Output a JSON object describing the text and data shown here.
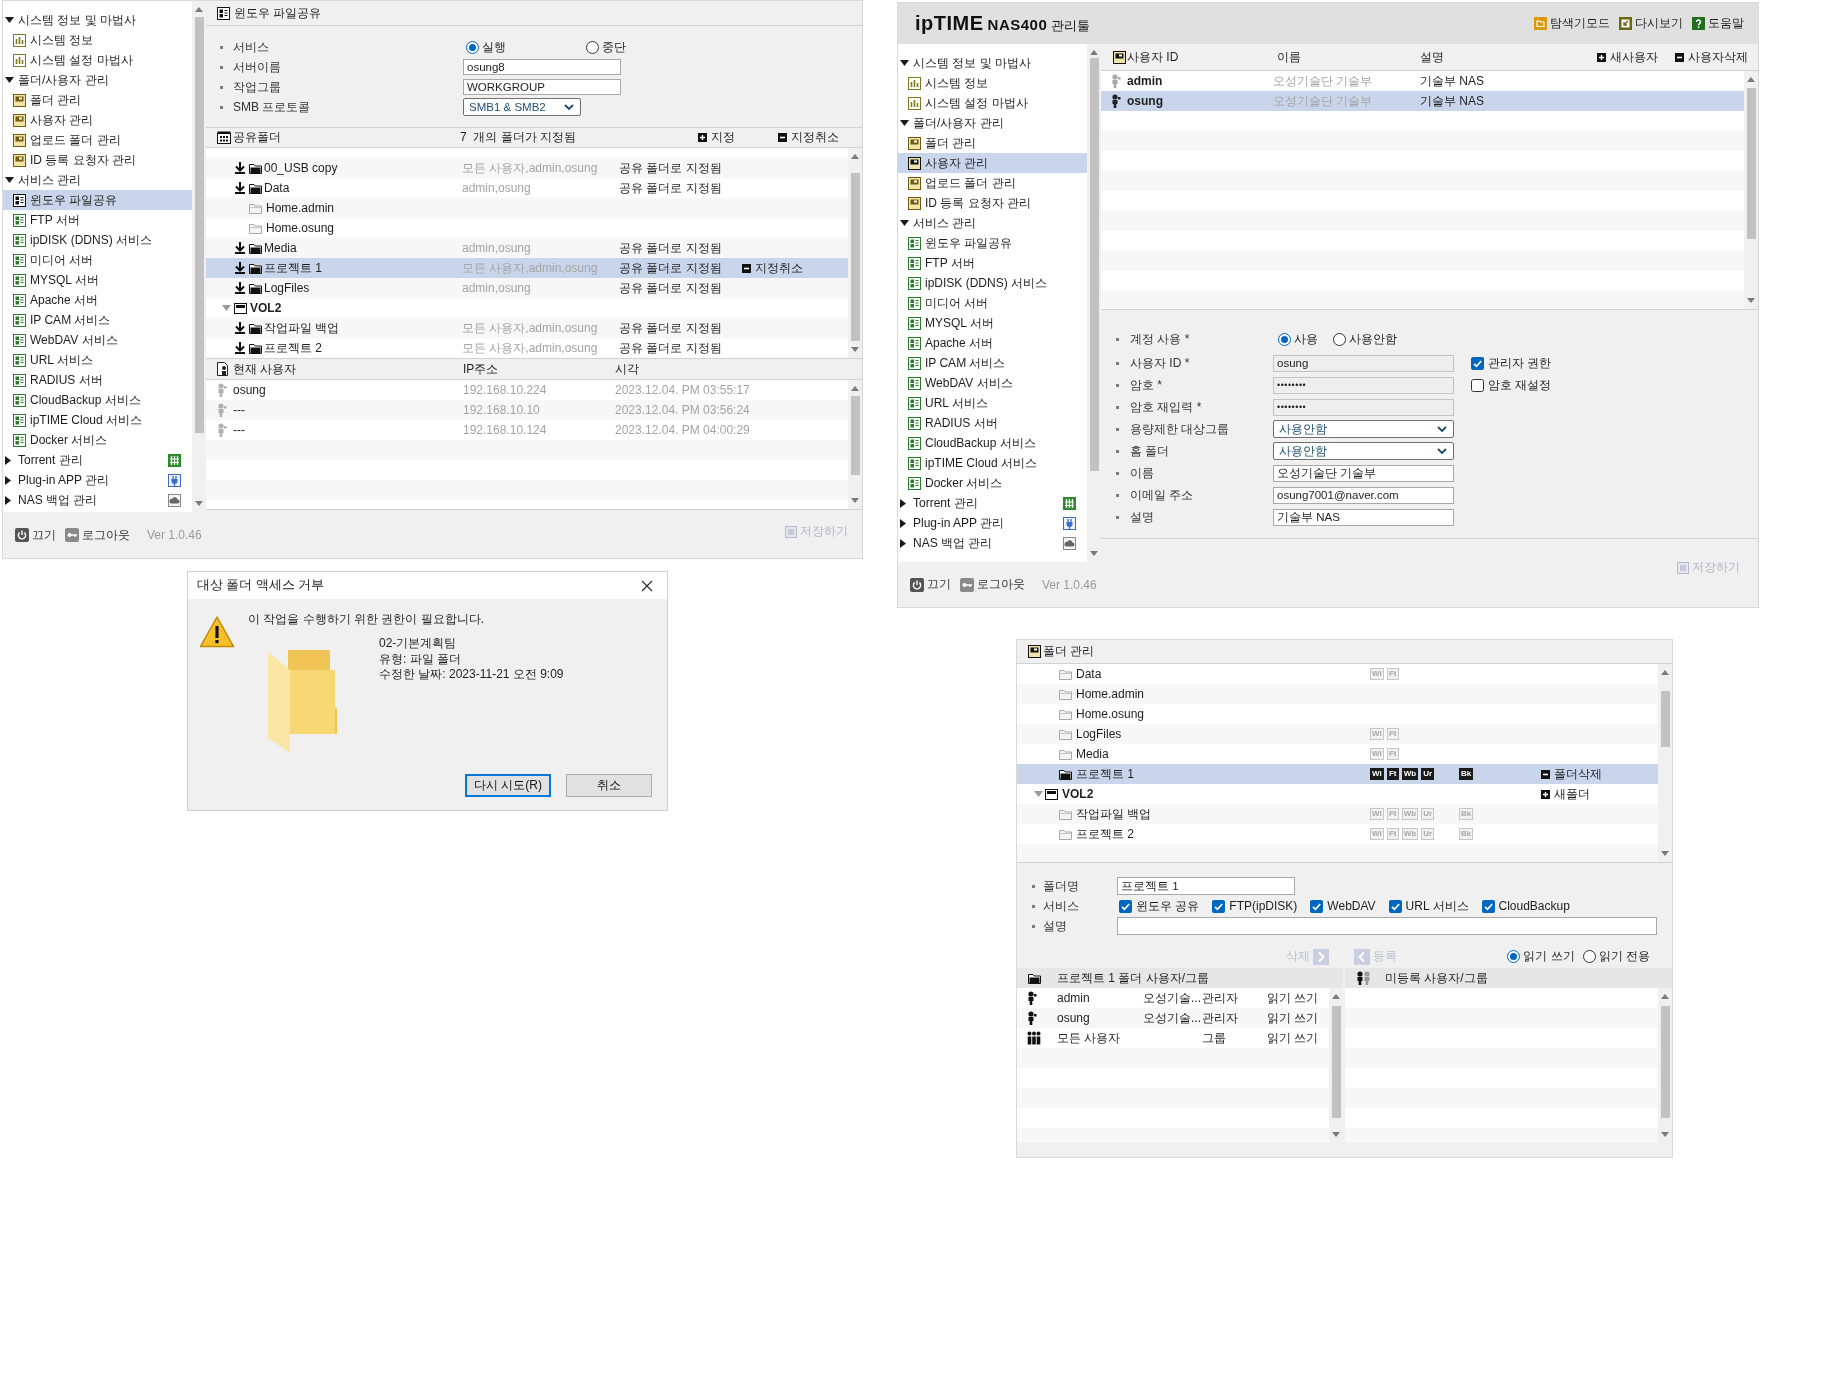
{
  "share_panel": {
    "sidebar": {
      "groups": [
        {
          "label": "시스템 정보 및 마법사",
          "kind": "system",
          "expanded": true,
          "children": [
            {
              "label": "시스템 정보",
              "selected": false
            },
            {
              "label": "시스템 설정 마법사",
              "selected": false
            }
          ]
        },
        {
          "label": "폴더/사용자 관리",
          "kind": "storage",
          "expanded": true,
          "children": [
            {
              "label": "폴더 관리",
              "selected": false
            },
            {
              "label": "사용자 관리",
              "selected": false
            },
            {
              "label": "업로드 폴더 관리",
              "selected": false
            },
            {
              "label": "ID 등록 요청자 관리",
              "selected": false
            }
          ]
        },
        {
          "label": "서비스 관리",
          "kind": "service",
          "expanded": true,
          "children": [
            {
              "label": "윈도우 파일공유",
              "selected": true
            },
            {
              "label": "FTP 서버",
              "selected": false
            },
            {
              "label": "ipDISK (DDNS) 서비스",
              "selected": false
            },
            {
              "label": "미디어 서버",
              "selected": false
            },
            {
              "label": "MYSQL 서버",
              "selected": false
            },
            {
              "label": "Apache 서버",
              "selected": false
            },
            {
              "label": "IP CAM 서비스",
              "selected": false
            },
            {
              "label": "WebDAV 서비스",
              "selected": false
            },
            {
              "label": "URL 서비스",
              "selected": false
            },
            {
              "label": "RADIUS 서버",
              "selected": false
            },
            {
              "label": "CloudBackup 서비스",
              "selected": false
            },
            {
              "label": "ipTIME Cloud 서비스",
              "selected": false
            },
            {
              "label": "Docker 서비스",
              "selected": false
            }
          ]
        },
        {
          "label": "Torrent 관리",
          "kind": "torrent",
          "expanded": false
        },
        {
          "label": "Plug-in APP 관리",
          "kind": "plugin",
          "expanded": false
        },
        {
          "label": "NAS 백업 관리",
          "kind": "backup",
          "expanded": false
        }
      ]
    },
    "footer": {
      "power": "끄기",
      "logout": "로그아웃",
      "version": "Ver 1.0.46"
    },
    "title": "윈도우 파일공유",
    "settings": [
      {
        "label": "서비스",
        "kind": "radio",
        "options": [
          {
            "label": "실행",
            "selected": true
          },
          {
            "label": "중단",
            "selected": false
          }
        ]
      },
      {
        "label": "서버이름",
        "kind": "text",
        "value": "osung8"
      },
      {
        "label": "작업그룹",
        "kind": "text",
        "value": "WORKGROUP"
      },
      {
        "label": "SMB 프로토콜",
        "kind": "select",
        "value": "SMB1 & SMB2"
      }
    ],
    "shared_folders": {
      "title": "공유폴더",
      "summary": "7  개의 폴더가 지정됨",
      "add": "지정",
      "remove": "지정취소",
      "volumes": [
        {
          "children": [
            {
              "name": "00_USB copy",
              "shared": true,
              "users": "모든 사용자,admin,osung",
              "status": "공유 폴더로 지정됨",
              "selected": false
            },
            {
              "name": "Data",
              "shared": true,
              "users": "admin,osung",
              "status": "공유 폴더로 지정됨",
              "selected": false
            },
            {
              "name": "Home.admin",
              "shared": false,
              "selected": false
            },
            {
              "name": "Home.osung",
              "shared": false,
              "selected": false
            },
            {
              "name": "Media",
              "shared": true,
              "users": "admin,osung",
              "status": "공유 폴더로 지정됨",
              "selected": false
            },
            {
              "name": "프로젝트 1",
              "shared": true,
              "users": "모든 사용자,admin,osung",
              "status": "공유 폴더로 지정됨",
              "selected": true,
              "action": {
                "label": "지정취소",
                "kind": "remove"
              }
            },
            {
              "name": "LogFiles",
              "shared": true,
              "users": "admin,osung",
              "status": "공유 폴더로 지정됨",
              "selected": false
            }
          ]
        },
        {
          "label": "VOL2",
          "expanded": true,
          "selected": false,
          "children": [
            {
              "name": "작업파일 백업",
              "shared": true,
              "users": "모든 사용자,admin,osung",
              "status": "공유 폴더로 지정됨",
              "selected": false
            },
            {
              "name": "프로젝트 2",
              "shared": true,
              "users": "모든 사용자,admin,osung",
              "status": "공유 폴더로 지정됨",
              "selected": false
            }
          ]
        }
      ]
    },
    "current_users": {
      "title": "현재 사용자",
      "columns": [
        "IP주소",
        "시각"
      ],
      "rows": [
        {
          "user": "osung",
          "ip": "192.168.10.224",
          "time": "2023.12.04. PM 03:55:17"
        },
        {
          "user": "---",
          "ip": "192.168.10.10",
          "time": "2023.12.04. PM 03:56:24"
        },
        {
          "user": "---",
          "ip": "192.168.10.124",
          "time": "2023.12.04. PM 04:00:29"
        }
      ]
    },
    "save": {
      "label": "저장하기",
      "disabled": true
    }
  },
  "user_panel": {
    "brand": {
      "logo": "ipTIME",
      "model": "NAS400",
      "title": "관리툴"
    },
    "toolbar": [
      {
        "label": "탐색기모드",
        "kind": "explorer"
      },
      {
        "label": "다시보기",
        "kind": "refresh"
      },
      {
        "label": "도움말",
        "kind": "help"
      }
    ],
    "sidebar": {
      "groups": [
        {
          "label": "시스템 정보 및 마법사",
          "kind": "system",
          "expanded": true,
          "children": [
            {
              "label": "시스템 정보",
              "selected": false
            },
            {
              "label": "시스템 설정 마법사",
              "selected": false
            }
          ]
        },
        {
          "label": "폴더/사용자 관리",
          "kind": "storage",
          "expanded": true,
          "children": [
            {
              "label": "폴더 관리",
              "selected": false
            },
            {
              "label": "사용자 관리",
              "selected": true
            },
            {
              "label": "업로드 폴더 관리",
              "selected": false
            },
            {
              "label": "ID 등록 요청자 관리",
              "selected": false
            }
          ]
        },
        {
          "label": "서비스 관리",
          "kind": "service",
          "expanded": true,
          "children": [
            {
              "label": "윈도우 파일공유",
              "selected": false
            },
            {
              "label": "FTP 서버",
              "selected": false
            },
            {
              "label": "ipDISK (DDNS) 서비스",
              "selected": false
            },
            {
              "label": "미디어 서버",
              "selected": false
            },
            {
              "label": "MYSQL 서버",
              "selected": false
            },
            {
              "label": "Apache 서버",
              "selected": false
            },
            {
              "label": "IP CAM 서비스",
              "selected": false
            },
            {
              "label": "WebDAV 서비스",
              "selected": false
            },
            {
              "label": "URL 서비스",
              "selected": false
            },
            {
              "label": "RADIUS 서버",
              "selected": false
            },
            {
              "label": "CloudBackup 서비스",
              "selected": false
            },
            {
              "label": "ipTIME Cloud 서비스",
              "selected": false
            },
            {
              "label": "Docker 서비스",
              "selected": false
            }
          ]
        },
        {
          "label": "Torrent 관리",
          "kind": "torrent",
          "expanded": false
        },
        {
          "label": "Plug-in APP 관리",
          "kind": "plugin",
          "expanded": false
        },
        {
          "label": "NAS 백업 관리",
          "kind": "backup",
          "expanded": false
        }
      ]
    },
    "users": {
      "columns": [
        "사용자 ID",
        "이름",
        "설명"
      ],
      "add": "새사용자",
      "remove": "사용자삭제",
      "rows": [
        {
          "id": "admin",
          "name": "오성기술단 기술부",
          "description": "기술부 NAS",
          "selected": false
        },
        {
          "id": "osung",
          "name": "오성기술단 기술부",
          "description": "기술부 NAS",
          "selected": true
        }
      ]
    },
    "form": [
      {
        "label": "계정 사용 *",
        "kind": "radio",
        "options": [
          {
            "label": "사용",
            "selected": true
          },
          {
            "label": "사용안함",
            "selected": false
          }
        ]
      },
      {
        "label": "사용자 ID *",
        "kind": "readonly",
        "value": "osung",
        "check": {
          "label": "관리자 권한",
          "checked": true
        }
      },
      {
        "label": "암호 *",
        "kind": "password",
        "value": "••••••••",
        "check": {
          "label": "암호 재설정",
          "checked": false
        }
      },
      {
        "label": "암호 재입력 *",
        "kind": "password",
        "value": "••••••••"
      },
      {
        "label": "용량제한 대상그룹",
        "kind": "select",
        "value": "사용안함"
      },
      {
        "label": "홈 폴더",
        "kind": "select",
        "value": "사용안함"
      },
      {
        "label": "이름",
        "kind": "text",
        "value": "오성기술단 기술부"
      },
      {
        "label": "이메일 주소",
        "kind": "text",
        "value": "osung7001@naver.com"
      },
      {
        "label": "설명",
        "kind": "wide",
        "value": "기술부 NAS"
      }
    ],
    "save": {
      "label": "저장하기",
      "disabled": true
    },
    "footer": {
      "power": "끄기",
      "logout": "로그아웃",
      "version": "Ver 1.0.46"
    }
  },
  "folder_panel": {
    "title": "폴더 관리",
    "volumes": [
      {
        "children": [
          {
            "name": "Data",
            "selected": false,
            "badges": [
              "Wi",
              "Ft"
            ]
          },
          {
            "name": "Home.admin",
            "selected": false
          },
          {
            "name": "Home.osung",
            "selected": false
          },
          {
            "name": "LogFiles",
            "selected": false,
            "badges": [
              "Wi",
              "Ft"
            ]
          },
          {
            "name": "Media",
            "selected": false,
            "badges": [
              "Wi",
              "Ft"
            ]
          },
          {
            "name": "프로젝트 1",
            "selected": true,
            "badges": [
              "Wi",
              "Ft",
              "Wb",
              "Ur"
            ],
            "backup": "Bk",
            "action": {
              "label": "폴더삭제",
              "kind": "remove"
            }
          }
        ]
      },
      {
        "label": "VOL2",
        "expanded": true,
        "selected": false,
        "action": {
          "label": "새폴더",
          "kind": "add"
        },
        "children": [
          {
            "name": "작업파일 백업",
            "selected": false,
            "badges": [
              "Wi",
              "Ft",
              "Wb",
              "Ur"
            ],
            "backup": "Bk"
          },
          {
            "name": "프로젝트 2",
            "selected": false,
            "badges": [
              "Wi",
              "Ft",
              "Wb",
              "Ur"
            ],
            "backup": "Bk"
          }
        ]
      }
    ],
    "form": [
      {
        "label": "폴더명",
        "kind": "text",
        "value": "프로젝트 1"
      },
      {
        "label": "서비스",
        "kind": "checks",
        "options": [
          {
            "label": "윈도우 공유",
            "checked": true
          },
          {
            "label": "FTP(ipDISK)",
            "checked": true
          },
          {
            "label": "WebDAV",
            "checked": true
          },
          {
            "label": "URL 서비스",
            "checked": true
          },
          {
            "label": "CloudBackup",
            "checked": true
          }
        ]
      },
      {
        "label": "설명",
        "kind": "wide"
      }
    ],
    "transfer": [
      {
        "label": "삭제",
        "kind": "remove",
        "disabled": true
      },
      {
        "label": "등록",
        "kind": "add",
        "disabled": true
      }
    ],
    "access": [
      {
        "label": "읽기 쓰기",
        "selected": true
      },
      {
        "label": "읽기 전용",
        "selected": false
      }
    ],
    "members": {
      "title": "프로젝트 1 폴더 사용자/그룹",
      "rows": [
        {
          "kind": "user",
          "name": "admin",
          "display": "오성기술...",
          "role": "관리자",
          "access": "읽기 쓰기",
          "selected": false
        },
        {
          "kind": "user",
          "name": "osung",
          "display": "오성기술...",
          "role": "관리자",
          "access": "읽기 쓰기",
          "selected": false
        },
        {
          "kind": "group",
          "name": "모든 사용자",
          "role": "그룹",
          "access": "읽기 쓰기",
          "selected": false
        }
      ]
    },
    "others": {
      "title": "미등록 사용자/그룹"
    }
  },
  "dialog": {
    "title": "대상 폴더 액세스 거부",
    "message": "이 작업을 수행하기 위한 권한이 필요합니다.",
    "details": [
      "02-기본계획팀",
      "유형: 파일 폴더",
      "수정한 날짜: 2023-11-21 오전 9:09"
    ],
    "buttons": [
      {
        "label": "다시 시도(R)",
        "default": true
      },
      {
        "label": "취소",
        "default": false
      }
    ]
  }
}
